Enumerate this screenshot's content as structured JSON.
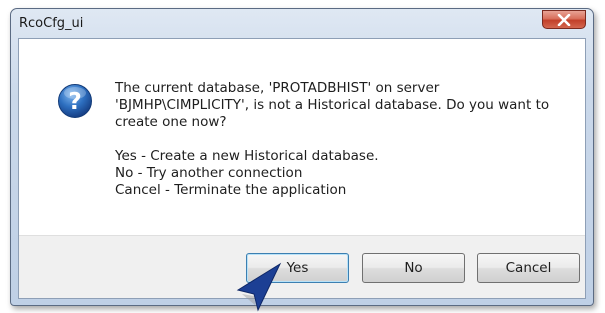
{
  "window": {
    "title": "RcoCfg_ui",
    "close_icon": "close-x-icon"
  },
  "dialog": {
    "icon": "question-icon",
    "message_lines": [
      "The current database, 'PROTADBHIST' on server",
      "'BJMHP\\CIMPLICITY', is not a Historical database. Do you want to",
      "create one now?"
    ],
    "option_lines": [
      "Yes - Create a new Historical database.",
      "No - Try another connection",
      "Cancel - Terminate the application"
    ]
  },
  "buttons": {
    "yes": "Yes",
    "no": "No",
    "cancel": "Cancel"
  },
  "colors": {
    "frame": "#c9d7ea",
    "close_button": "#c94a34",
    "icon_blue": "#2a6ab8",
    "pointer": "#1c3f94"
  }
}
